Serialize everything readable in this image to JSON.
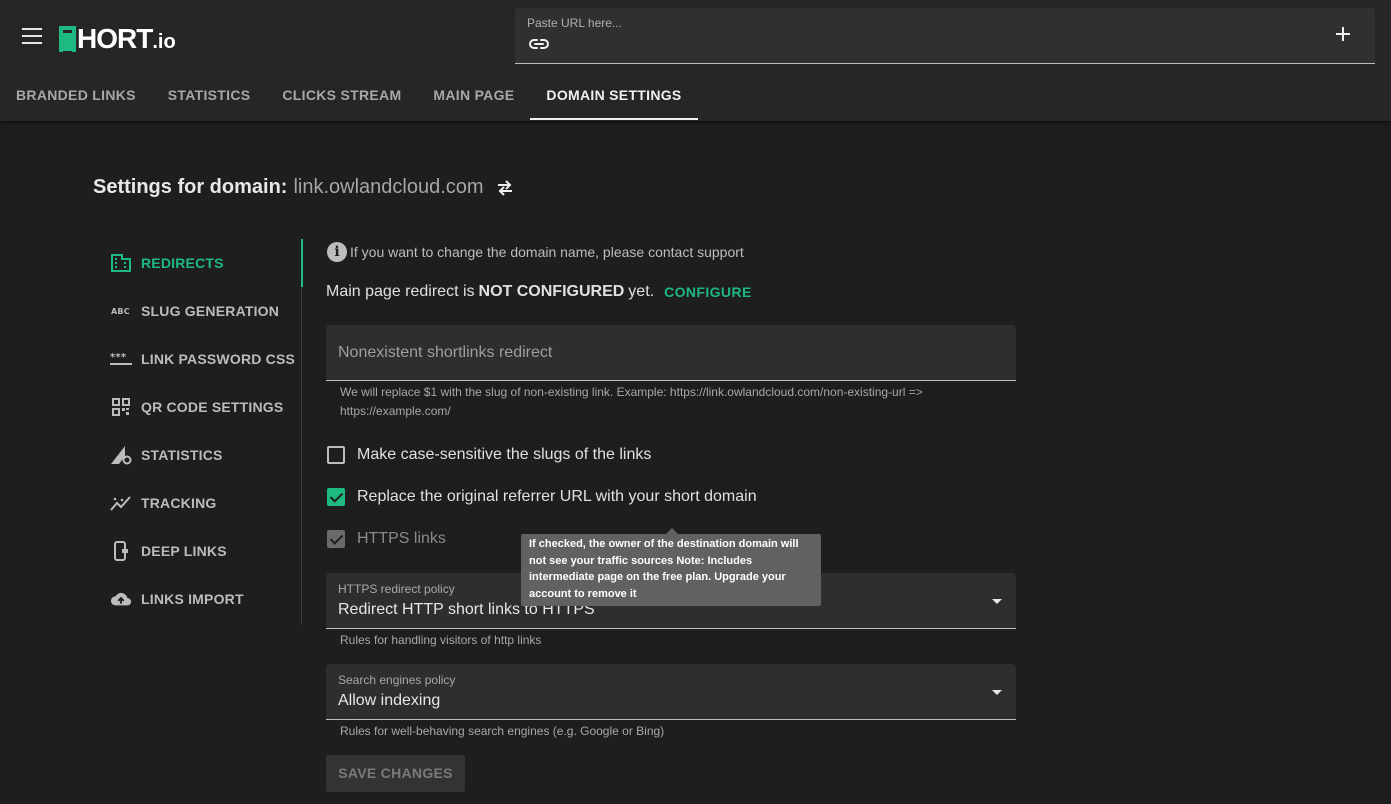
{
  "header": {
    "logo_main": "HORT",
    "logo_suffix": ".io",
    "url_placeholder": "Paste URL here...",
    "tabs": [
      {
        "label": "BRANDED LINKS"
      },
      {
        "label": "STATISTICS"
      },
      {
        "label": "CLICKS STREAM"
      },
      {
        "label": "MAIN PAGE"
      },
      {
        "label": "DOMAIN SETTINGS",
        "active": true
      }
    ]
  },
  "page": {
    "heading_label": "Settings for domain:",
    "domain": "link.owlandcloud.com"
  },
  "sidebar": {
    "items": [
      {
        "label": "REDIRECTS",
        "icon": "building-icon",
        "active": true
      },
      {
        "label": "SLUG GENERATION",
        "icon": "abc-icon"
      },
      {
        "label": "LINK PASSWORD CSS",
        "icon": "password-icon"
      },
      {
        "label": "QR CODE SETTINGS",
        "icon": "qr-code-icon"
      },
      {
        "label": "STATISTICS",
        "icon": "signal-gear-icon"
      },
      {
        "label": "TRACKING",
        "icon": "tracking-icon"
      },
      {
        "label": "DEEP LINKS",
        "icon": "phone-link-icon"
      },
      {
        "label": "LINKS IMPORT",
        "icon": "cloud-upload-icon"
      }
    ]
  },
  "main": {
    "info_text": "If you want to change the domain name, please contact support",
    "redirect_prefix": "Main page redirect is",
    "redirect_status": "NOT CONFIGURED",
    "redirect_suffix": "yet.",
    "configure_label": "CONFIGURE",
    "nonexistent_placeholder": "Nonexistent shortlinks redirect",
    "nonexistent_helper_line1": "We will replace $1 with the slug of non-existing link. Example: https://link.owlandcloud.com/non-existing-url =>",
    "nonexistent_helper_line2": "https://example.com/",
    "case_sensitive_label": "Make case-sensitive the slugs of the links",
    "replace_referrer_label": "Replace the original referrer URL with your short domain",
    "https_links_label": "HTTPS links",
    "tooltip_text": "If checked, the owner of the destination domain will not see your traffic sources Note: Includes intermediate page on the free plan. Upgrade your account to remove it",
    "https_policy_label": "HTTPS redirect policy",
    "https_policy_value": "Redirect HTTP short links to HTTPS",
    "https_policy_helper": "Rules for handling visitors of http links",
    "search_policy_label": "Search engines policy",
    "search_policy_value": "Allow indexing",
    "search_policy_helper": "Rules for well-behaving search engines (e.g. Google or Bing)",
    "save_label": "SAVE CHANGES"
  },
  "colors": {
    "accent": "#1eb980",
    "background": "#1e1e1e",
    "header": "#262626"
  }
}
